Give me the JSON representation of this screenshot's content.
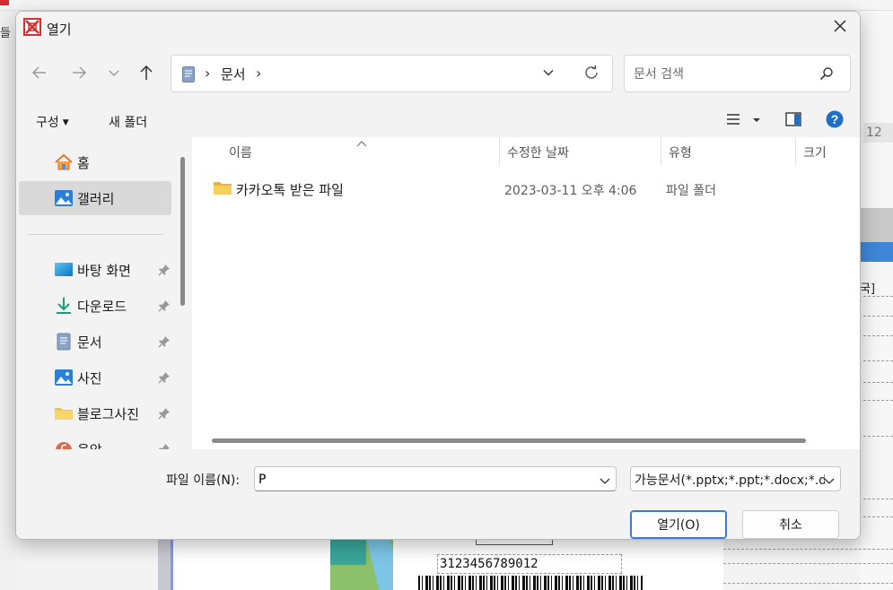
{
  "window": {
    "title": "열기"
  },
  "background": {
    "left_char": "들",
    "number_cell": "12",
    "side_text": "국]",
    "barcode_text": "3123456789012"
  },
  "nav": {
    "back": "back",
    "forward": "forward",
    "recent": "recent-locations",
    "up": "up"
  },
  "address": {
    "location": "문서",
    "separator": "›"
  },
  "search": {
    "placeholder": "문서 검색",
    "value": ""
  },
  "toolbar": {
    "organize_label": "구성",
    "new_folder_label": "새 폴더"
  },
  "sidebar": {
    "items": [
      {
        "label": "홈",
        "icon": "home-icon",
        "pinned": false
      },
      {
        "label": "갤러리",
        "icon": "gallery-icon",
        "pinned": false,
        "selected": true
      },
      {
        "label": "바탕 화면",
        "icon": "desktop-icon",
        "pinned": true
      },
      {
        "label": "다운로드",
        "icon": "download-icon",
        "pinned": true
      },
      {
        "label": "문서",
        "icon": "document-icon",
        "pinned": true
      },
      {
        "label": "사진",
        "icon": "pictures-icon",
        "pinned": true
      },
      {
        "label": "블로그사진",
        "icon": "folder-icon",
        "pinned": true
      },
      {
        "label": "음악",
        "icon": "music-icon",
        "pinned": true
      }
    ]
  },
  "filelist": {
    "columns": [
      "이름",
      "수정한 날짜",
      "유형",
      "크기"
    ],
    "rows": [
      {
        "name": "카카오톡 받은 파일",
        "modified": "2023-03-11 오후 4:06",
        "type": "파일 폴더",
        "size": ""
      }
    ]
  },
  "footer": {
    "filename_label": "파일 이름(N):",
    "filename_value": "P",
    "filetype_value": "가능문서(*.pptx;*.ppt;*.docx;*.doc",
    "open_label": "열기(O)",
    "cancel_label": "취소"
  },
  "colors": {
    "accent": "#3b78d8",
    "help": "#1f6fc9",
    "folder": "#f2c34a",
    "selected_bg": "#d9d9d9"
  }
}
